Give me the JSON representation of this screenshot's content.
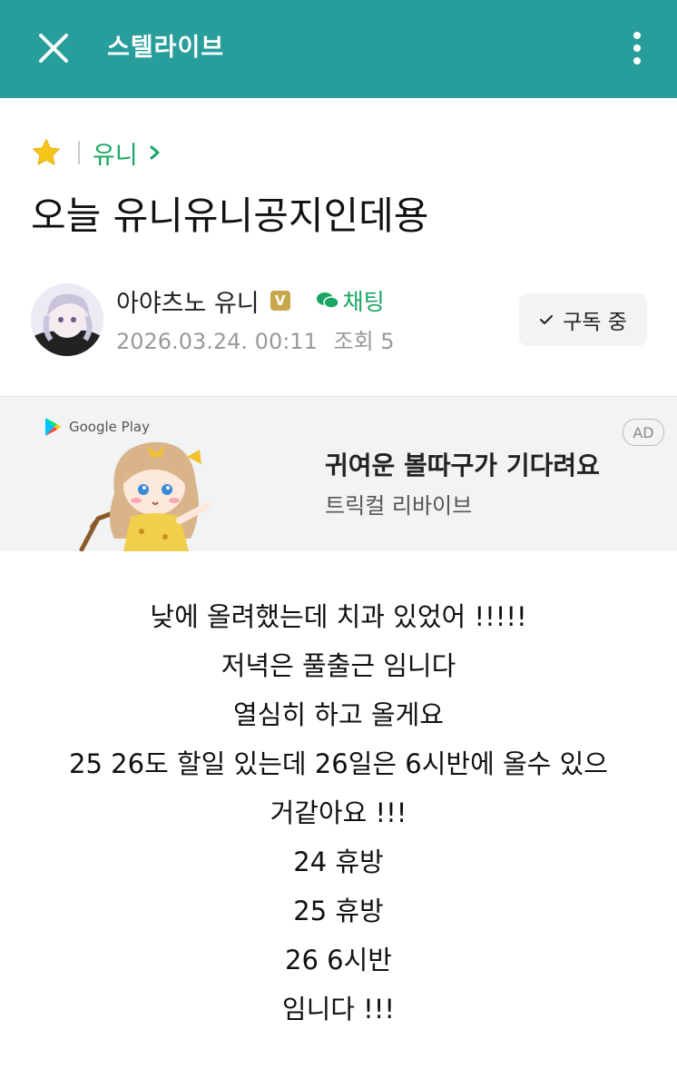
{
  "colors": {
    "accent": "#279E9B",
    "board_green": "#18A662",
    "verified_badge": "#C8A84B"
  },
  "topbar": {
    "brand": "스텔라이브",
    "close_icon": "close-icon",
    "more_icon": "more-vertical-icon"
  },
  "breadcrumb": {
    "icon": "star-icon",
    "board": "유니",
    "chevron_icon": "chevron-right-icon"
  },
  "post": {
    "title": "오늘 유니유니공지인데용",
    "author": "아야츠노 유니",
    "verified_badge": "V",
    "chat_label": "채팅",
    "date": "2026.03.24. 00:11",
    "views": "조회 5",
    "subscribe_label": "구독 중",
    "body_lines": [
      "낮에 올려했는데 치과 있었어 !!!!!",
      "저녁은 풀출근 임니다",
      "열심히 하고 올게요",
      "25 26도 할일 있는데 26일은 6시반에 올수 있으",
      "거같아요 !!!",
      "24 휴방",
      "25 휴방",
      "26 6시반",
      "임니다 !!!"
    ]
  },
  "ad": {
    "store_label": "Google Play",
    "badge": "AD",
    "headline": "귀여운 볼따구가 기다려요",
    "subtitle": "트릭컬 리바이브"
  }
}
